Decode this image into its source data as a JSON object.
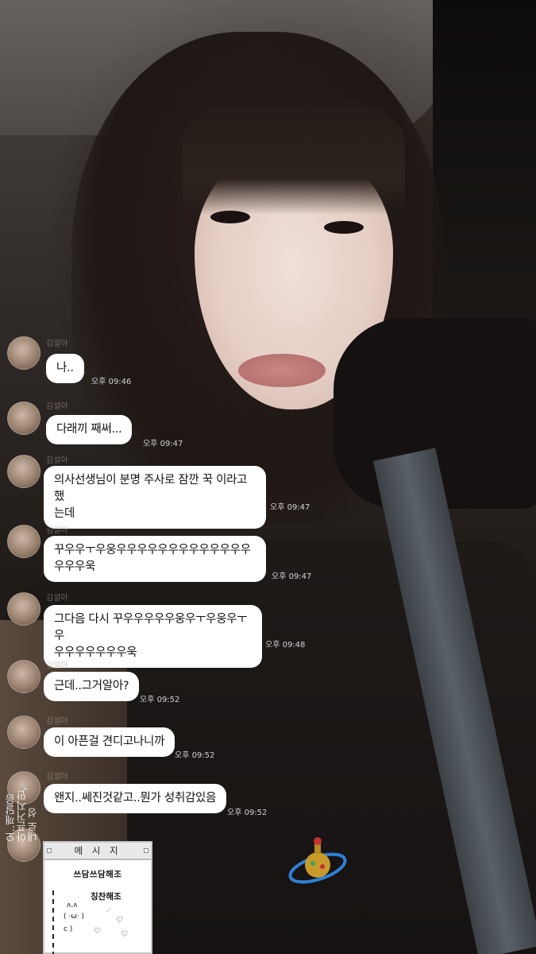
{
  "messages": [
    {
      "sender": "김설아",
      "text": "나..",
      "time": "오후 09:46"
    },
    {
      "sender": "김설아",
      "text": "다래끼 째써...",
      "time": "오후 09:47"
    },
    {
      "sender": "김설아",
      "text": "의사선생님이 분명 주사로 잠깐 꾹 이라고 했는데",
      "time": "오후 09:47"
    },
    {
      "sender": "김설아",
      "text": "꾸우우ㅜ우웅우우우우우우우우우우우우우우우우우욱",
      "time": "오후 09:47"
    },
    {
      "sender": "김설아",
      "text": "그다음 다시 꾸우우우우우웅우ㅜ우웅우ㅜ우우우우우우우우욱",
      "time": "오후 09:48"
    },
    {
      "sender": "김설아",
      "text": "근데..그거알아?",
      "time": "오후 09:52"
    },
    {
      "sender": "김설아",
      "text": "이 아픈걸 견디고나니까",
      "time": "오후 09:52"
    },
    {
      "sender": "김설아",
      "text": "왠지..쎄진것같고..뭔가 성취감있음",
      "time": "오후 09:52"
    }
  ],
  "bubble_lines": {
    "m3": [
      "의사선생님이 분명 주사로 잠깐 꾹 이라고 했",
      "는데"
    ],
    "m4": [
      "꾸우우ㅜ우웅우우우우우우우우우우우우우",
      "우우우욱"
    ],
    "m5": [
      "그다음 다시 꾸우우우우우웅우ㅜ우웅우ㅜ우",
      "우우우우우우우욱"
    ]
  },
  "vertical_text": [
    "오..깨달음",
    "아픈거지만,",
    "내로 성"
  ],
  "message_window": {
    "title": "메 시 지",
    "line1": "쓰담쓰담해조",
    "line2": "칭찬해조",
    "kaomoji": [
      "ʌ.ʌ",
      "( ·ω· )",
      "c    )"
    ]
  }
}
